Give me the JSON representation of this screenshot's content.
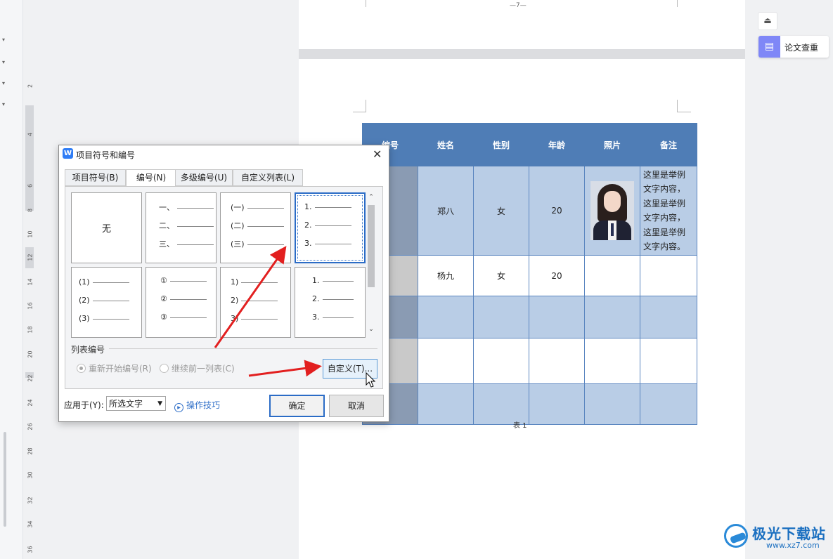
{
  "page_number": "—7—",
  "ruler_marks": [
    "2",
    "4",
    "6",
    "8",
    "10",
    "12",
    "14",
    "16",
    "18",
    "20",
    "22",
    "24",
    "26",
    "28",
    "30",
    "32",
    "34",
    "36"
  ],
  "table": {
    "headers": [
      "编号",
      "姓名",
      "性别",
      "年龄",
      "照片",
      "备注"
    ],
    "rows": [
      {
        "name": "郑八",
        "gender": "女",
        "age": "20",
        "remark": [
          "这里是举例",
          "文字内容，",
          "这里是举例",
          "文字内容，",
          "这里是举例",
          "文字内容。"
        ]
      },
      {
        "name": "杨九",
        "gender": "女",
        "age": "20"
      }
    ],
    "caption": "表 1"
  },
  "side_panel": {
    "thesis_check_label": "论文查重"
  },
  "dialog": {
    "title": "项目符号和编号",
    "tabs": [
      "项目符号(B)",
      "编号(N)",
      "多级编号(U)",
      "自定义列表(L)"
    ],
    "active_tab": "编号(N)",
    "gallery": {
      "none_label": "无",
      "cells": [
        [
          "一、",
          "二、",
          "三、"
        ],
        [
          "(一)",
          "(二)",
          "(三)"
        ],
        [
          "1.",
          "2.",
          "3."
        ],
        [
          "(1)",
          "(2)",
          "(3)"
        ],
        [
          "①",
          "②",
          "③"
        ],
        [
          "1)",
          "2)",
          "3)"
        ],
        [
          "1.",
          "2.",
          "3."
        ]
      ]
    },
    "section_label": "列表编号",
    "restart_label": "重新开始编号(R)",
    "continue_label": "继续前一列表(C)",
    "custom_button": "自定义(T)...",
    "apply_label": "应用于(Y):",
    "apply_value": "所选文字",
    "tips_label": "操作技巧",
    "ok_button": "确定",
    "cancel_button": "取消"
  },
  "watermark": {
    "name": "极光下载站",
    "url": "www.xz7.com"
  },
  "colors": {
    "header_blue": "#4f7db6",
    "row_blue": "#b9cde6",
    "accent": "#2b6cc6",
    "arrow": "#e21f1f"
  }
}
